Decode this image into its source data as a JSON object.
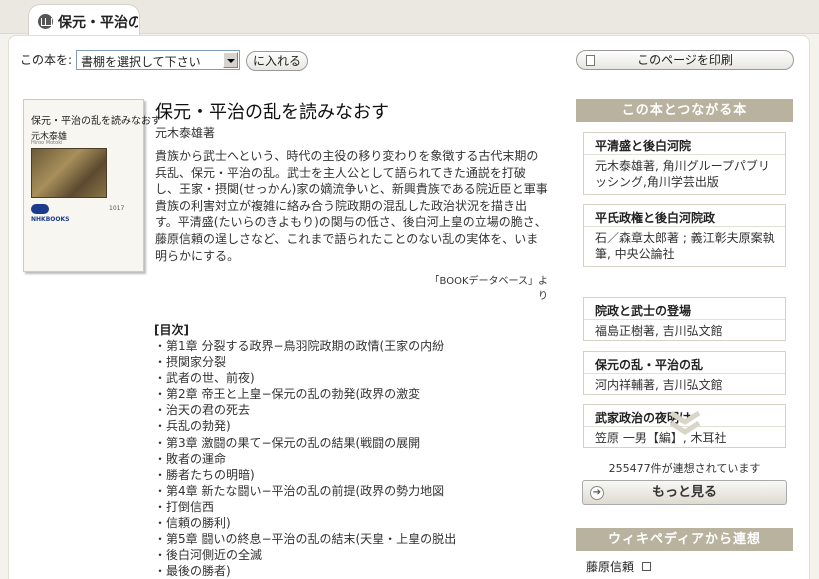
{
  "tab": {
    "title": "保元・平治の"
  },
  "shelf": {
    "label": "この本を:",
    "selected": "書棚を選択して下さい",
    "add_label": "に入れる"
  },
  "print": {
    "label": "このページを印刷"
  },
  "book": {
    "title": "保元・平治の乱を読みなおす",
    "author": "元木泰雄著",
    "description": "貴族から武士へという、時代の主役の移り変わりを象徴する古代末期の兵乱、保元・平治の乱。武士を主人公として語られてきた通説を打破し、王家・摂関(せっかん)家の嫡流争いと、新興貴族である院近臣と軍事貴族の利害対立が複雑に絡み合う院政期の混乱した政治状況を描き出す。平清盛(たいらのきよもり)の関与の低さ、後白河上皇の立場の脆さ、藤原信頼の逞しさなど、これまで語られたことのない乱の実体を、いま明らかにする。",
    "source": "「BOOKデータベース」より",
    "cover": {
      "title": "保元・平治の乱を読みなおす",
      "author": "元木泰雄",
      "romaji": "Hiroo Motoki",
      "number": "1017",
      "series": "NHKBOOKS"
    }
  },
  "toc": {
    "heading": "[目次]",
    "items": [
      "・第1章 分裂する政界−鳥羽院政期の政情(王家の内紛",
      "・摂関家分裂",
      "・武者の世、前夜)",
      "・第2章 帝王と上皇−保元の乱の勃発(政界の激変",
      "・治天の君の死去",
      "・兵乱の勃発)",
      "・第3章 激闘の果て−保元の乱の結果(戦闘の展開",
      "・敗者の運命",
      "・勝者たちの明暗)",
      "・第4章 新たな闘い−平治の乱の前提(政界の勢力地図",
      "・打倒信西",
      "・信頼の勝利)",
      "・第5章 闘いの終息−平治の乱の結末(天皇・上皇の脱出",
      "・後白河側近の全滅",
      "・最後の勝者)"
    ]
  },
  "sidebar": {
    "related_heading": "この本とつながる本",
    "related": [
      {
        "title": "平清盛と後白河院",
        "meta": "元木泰雄著, 角川グループパブリッシング,角川学芸出版"
      },
      {
        "title": "平氏政権と後白河院政",
        "meta": "石／森章太郎著 ; 義江彰夫原案執筆, 中央公論社"
      },
      {
        "title": "院政と武士の登場",
        "meta": "福島正樹著, 吉川弘文館"
      },
      {
        "title": "保元の乱・平治の乱",
        "meta": "河内祥輔著, 吉川弘文館"
      },
      {
        "title": "武家政治の夜明け",
        "meta": "笠原 一男【編】, 木耳社"
      }
    ],
    "connect_count": "255477件が連想されています",
    "more_label": "もっと見る",
    "wiki_heading": "ウィキペディアから連想",
    "wiki_link": "藤原信頼"
  }
}
